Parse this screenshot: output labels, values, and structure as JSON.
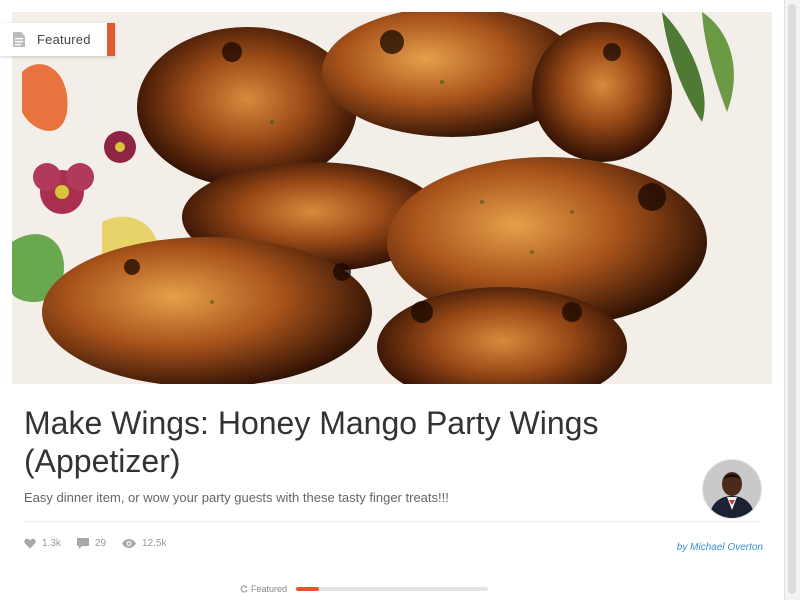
{
  "post": {
    "badge_label": "Featured",
    "title": "Make Wings: Honey Mango Party Wings (Appetizer)",
    "description": "Easy dinner item, or wow your party guests with these tasty finger treats!!!",
    "author": "by Michael Overton",
    "stats": {
      "likes": "1.3k",
      "comments": "29",
      "views": "12.5k"
    }
  },
  "carousel": {
    "label": "Featured",
    "progress": 0.12
  },
  "colors": {
    "accent": "#e05a2b",
    "author_link": "#3a8fd0"
  },
  "icons": {
    "badge": "document-icon",
    "likes": "heart-icon",
    "comments": "comment-icon",
    "views": "eye-icon",
    "carousel": "refresh-icon"
  }
}
